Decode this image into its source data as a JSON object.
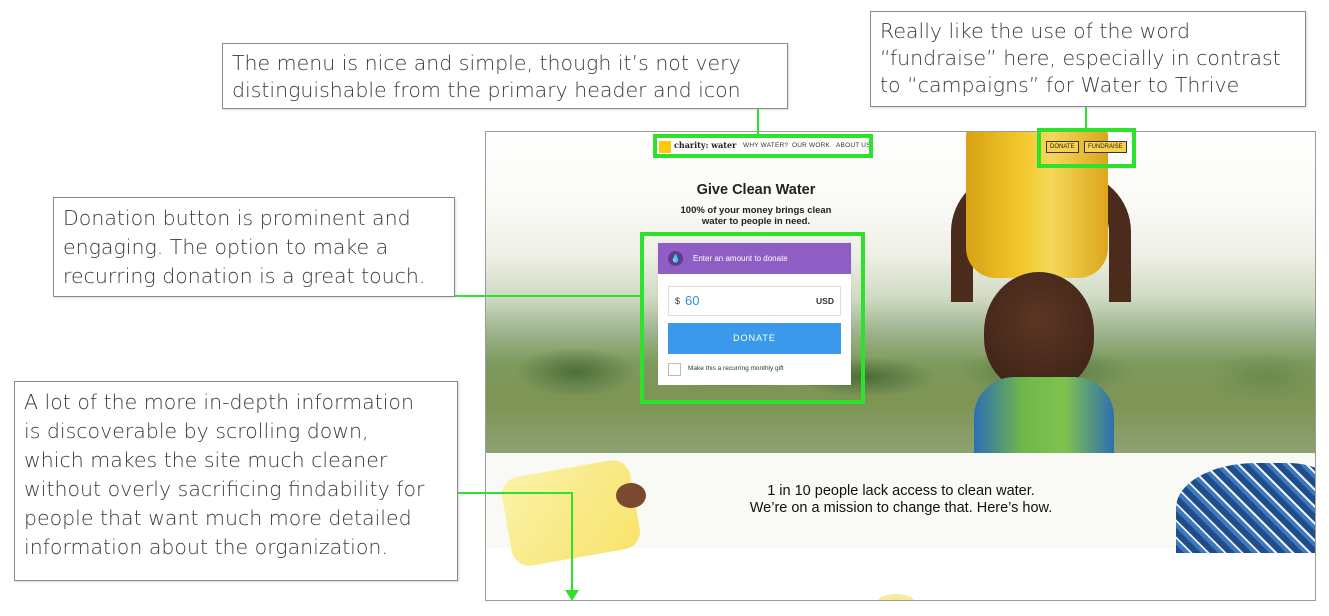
{
  "annotations": {
    "menu": "The menu is nice and simple, though it’s not very\ndistinguishable from the primary header and icon",
    "fundraise": "Really like the use of the word\n“fundraise” here, especially in contrast\nto “campaigns” for Water to Thrive",
    "donation": "Donation button is prominent and\nengaging. The option to make a\nrecurring donation is a great touch.",
    "scroll": "A lot of the more in-depth information\nis discoverable by scrolling down,\nwhich makes the site much cleaner\nwithout overly sacrificing findability for\npeople that want much more detailed\ninformation about the organization."
  },
  "site": {
    "brand": "charity: water",
    "nav": [
      "WHY WATER?",
      "OUR WORK",
      "ABOUT US"
    ],
    "header_buttons": [
      "DONATE",
      "FUNDRAISE"
    ],
    "hero_title": "Give Clean Water",
    "hero_subtitle": "100% of your money brings clean\nwater to people in need.",
    "donate_prompt": "Enter an amount to donate",
    "currency_symbol": "$",
    "amount": "60",
    "currency": "USD",
    "donate_button": "DONATE",
    "recurring_label": "Make this a recurring monthly gift",
    "band_text": "1 in 10 people lack access to clean water.\nWe’re on a mission to change that. Here’s how."
  },
  "colors": {
    "highlight": "#2de12d",
    "donate_header": "#8f5ec5",
    "donate_button": "#3a99ea",
    "logo": "#ffc907"
  }
}
